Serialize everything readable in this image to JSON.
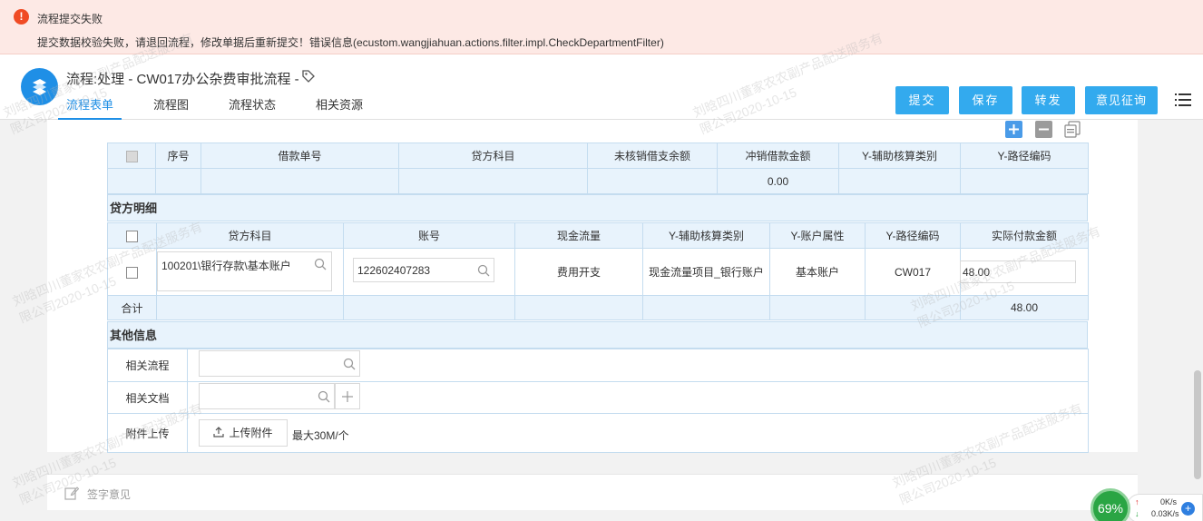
{
  "error": {
    "title": "流程提交失败",
    "message": "提交数据校验失败，请退回流程，修改单据后重新提交！错误信息(ecustom.wangjiahuan.actions.filter.impl.CheckDepartmentFilter)"
  },
  "header": {
    "title": "流程:处理 - CW017办公杂费审批流程 -",
    "tabs": [
      {
        "label": "流程表单"
      },
      {
        "label": "流程图"
      },
      {
        "label": "流程状态"
      },
      {
        "label": "相关资源"
      }
    ],
    "buttons": {
      "submit": "提交",
      "save": "保存",
      "forward": "转发",
      "opinion": "意见征询"
    }
  },
  "loan_table": {
    "headers": [
      "序号",
      "借款单号",
      "贷方科目",
      "未核销借支余额",
      "冲销借款金额",
      "Y-辅助核算类别",
      "Y-路径编码"
    ],
    "total_writeoff": "0.00"
  },
  "credit": {
    "section_title": "贷方明细",
    "headers": [
      "贷方科目",
      "账号",
      "现金流量",
      "Y-辅助核算类别",
      "Y-账户属性",
      "Y-路径编码",
      "实际付款金额"
    ],
    "row": {
      "subject": "100201\\银行存款\\基本账户",
      "account": "122602407283",
      "cash_flow": "费用开支",
      "aux_category": "现金流量项目_银行账户",
      "account_attr": "基本账户",
      "path_code": "CW017",
      "amount": "48.00"
    },
    "total_label": "合计",
    "total_amount": "48.00"
  },
  "other": {
    "section_title": "其他信息",
    "related_flow_label": "相关流程",
    "related_doc_label": "相关文档",
    "attachment_label": "附件上传",
    "upload_button": "上传附件",
    "max_size": "最大30M/个"
  },
  "sign": {
    "placeholder": "签字意见"
  },
  "net_monitor": {
    "percent": "69%",
    "up": "0K/s",
    "down": "0.03K/s"
  },
  "watermark": {
    "line1": "刘晗四川董家农农副产品配送服务有",
    "line2": "限公司2020-10-15"
  },
  "colors": {
    "accent": "#1f8fe6",
    "button": "#33aaee",
    "error": "#f04b24",
    "total_red": "#e02020"
  }
}
